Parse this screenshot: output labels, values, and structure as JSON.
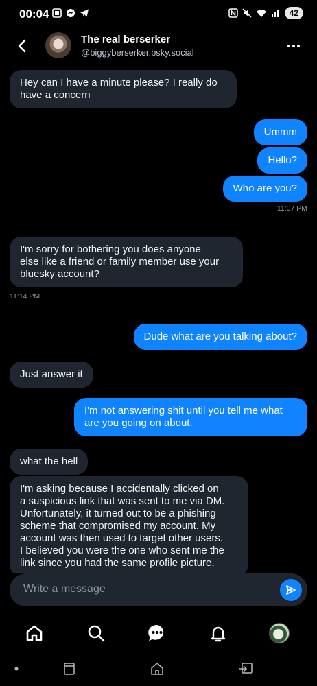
{
  "status_bar": {
    "time": "00:04",
    "battery": "42",
    "left_icons": [
      "screenshot-icon",
      "messenger-icon",
      "telegram-icon"
    ],
    "right_icons": [
      "nfc-icon",
      "mute-icon",
      "wifi-icon",
      "signal-icon"
    ]
  },
  "header": {
    "name": "The real berserker",
    "handle": "@biggyberserker.bsky.social"
  },
  "messages": [
    {
      "direction": "incoming",
      "lines": [
        "Hey can I have a minute please? I really do",
        "have a concern"
      ]
    },
    {
      "direction": "outgoing",
      "lines": [
        "Ummm"
      ]
    },
    {
      "direction": "outgoing",
      "lines": [
        "Hello?"
      ]
    },
    {
      "direction": "outgoing",
      "lines": [
        "Who are you?"
      ]
    },
    {
      "timestamp": "11:07 PM",
      "side": "right"
    },
    {
      "direction": "incoming",
      "lines": [
        "I'm sorry for bothering you does anyone",
        "else like a friend or family member use your",
        "bluesky account?"
      ]
    },
    {
      "timestamp": "11:14 PM",
      "side": "left"
    },
    {
      "direction": "outgoing",
      "lines": [
        "Dude what are you talking about?"
      ]
    },
    {
      "direction": "incoming",
      "lines": [
        "Just answer it"
      ]
    },
    {
      "direction": "outgoing",
      "lines": [
        "I'm not answering shit until you tell me what",
        "are you going on about."
      ]
    },
    {
      "direction": "incoming",
      "lines": [
        "what the hell"
      ]
    },
    {
      "direction": "incoming",
      "lines": [
        "I'm asking because I accidentally clicked on",
        "a suspicious link that was sent to me via DM.",
        "Unfortunately, it turned out to be a phishing",
        "scheme that compromised my account. My",
        "account was then used to target other users.",
        "I believed you were the one who sent me the",
        "link since you had the same profile picture,"
      ]
    }
  ],
  "composer": {
    "placeholder": "Write a message"
  },
  "tab_bar": {
    "items": [
      "home-icon",
      "search-icon",
      "chat-icon",
      "notifications-icon",
      "profile-avatar"
    ]
  },
  "system_nav": {
    "items": [
      "recents-dot",
      "tabs-icon",
      "home-icon",
      "back-icon"
    ]
  },
  "colors": {
    "background": "#000000",
    "incoming_bubble": "#1f262f",
    "outgoing_bubble": "#1083fe",
    "timestamp": "#8a96a3"
  }
}
